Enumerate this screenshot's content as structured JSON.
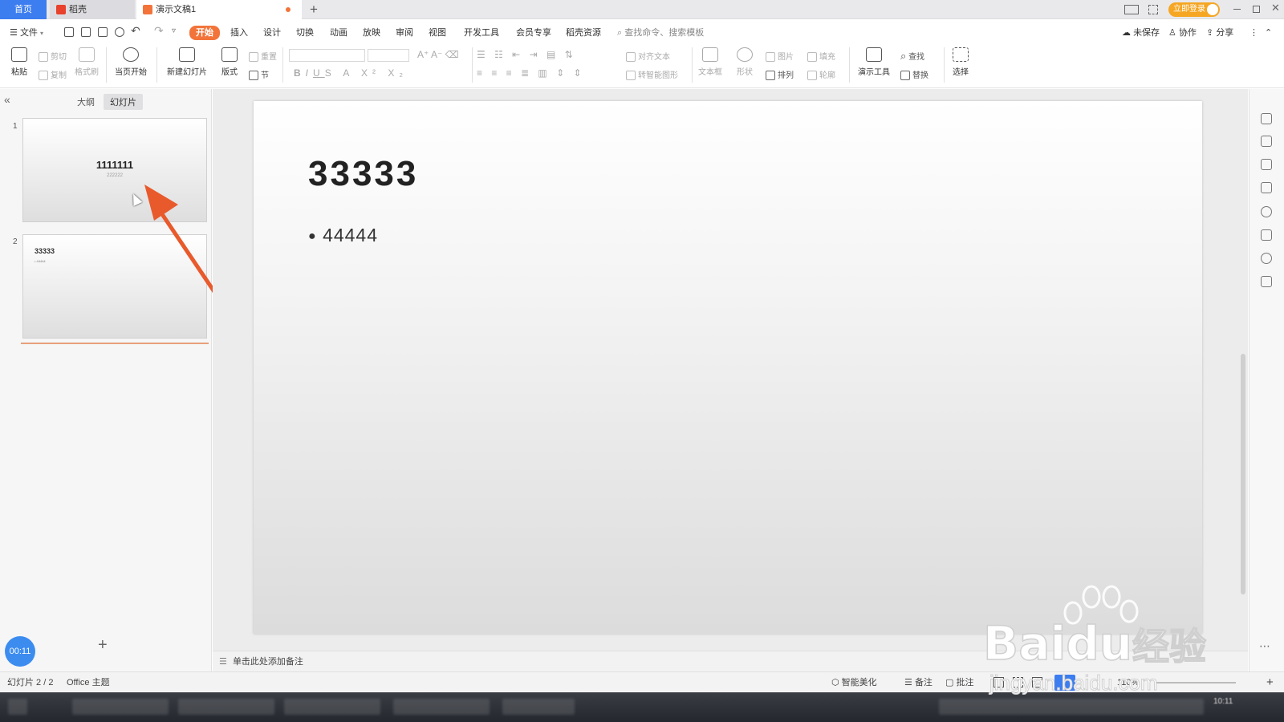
{
  "tabs": {
    "home": "首页",
    "daoke": "稻壳",
    "doc": "演示文稿1",
    "new_tab": "+"
  },
  "window": {
    "login": "立即登录"
  },
  "menubar": {
    "file": "文件",
    "items": [
      "开始",
      "插入",
      "设计",
      "切换",
      "动画",
      "放映",
      "审阅",
      "视图",
      "开发工具",
      "会员专享",
      "稻壳资源"
    ],
    "search_placeholder": "查找命令、搜索模板",
    "unsaved": "未保存",
    "collab": "协作",
    "share": "分享"
  },
  "ribbon": {
    "paste": "粘贴",
    "cut": "剪切",
    "copy": "复制",
    "format_painter": "格式刷",
    "start_from_current": "当页开始",
    "new_slide": "新建幻灯片",
    "layout": "版式",
    "reset": "重置",
    "section": "节",
    "align_text": "对齐文本",
    "smart_shape": "转智能图形",
    "textbox": "文本框",
    "shape": "形状",
    "picture": "图片",
    "fill": "填充",
    "arrange": "排列",
    "outline": "轮廓",
    "present_tools": "演示工具",
    "find": "查找",
    "replace": "替换",
    "select": "选择"
  },
  "left_panel": {
    "outline_tab": "大纲",
    "slides_tab": "幻灯片",
    "add": "+",
    "timer": "00:11"
  },
  "thumbnails": [
    {
      "number": "1",
      "title": "1111111",
      "subtitle": "222222"
    },
    {
      "number": "2",
      "title": "33333",
      "bullet": "44444"
    }
  ],
  "slide": {
    "title": "33333",
    "bullet": "44444"
  },
  "notes": {
    "placeholder": "单击此处添加备注"
  },
  "status": {
    "slide_index": "幻灯片 2 / 2",
    "theme": "Office 主题",
    "beautify": "智能美化",
    "notes": "备注",
    "comments": "批注",
    "zoom": "110%"
  },
  "taskbar": {
    "clock": "10:11"
  },
  "watermark": {
    "brand": "Bai",
    "brand2": "du",
    "cn": "经验",
    "url": "jingyan.baidu.com"
  },
  "colors": {
    "accent": "#f2743a",
    "blue": "#3c7df0",
    "arrow": "#e85a2c"
  }
}
